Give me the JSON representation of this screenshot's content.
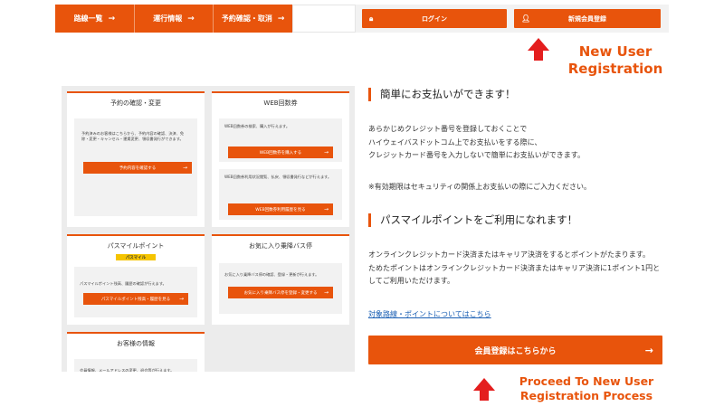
{
  "topnav": {
    "items": [
      {
        "label": "路線一覧"
      },
      {
        "label": "運行情報"
      },
      {
        "label": "予約確認・取消"
      }
    ]
  },
  "account": {
    "login_label": "ログイン",
    "register_label": "新規会員登録"
  },
  "annotations": {
    "new_user": "New User Registration",
    "proceed": "Proceed To New User Registration Process"
  },
  "cards": {
    "reserve": {
      "title": "予約の確認・変更",
      "body": "予約済みのお客様はこちらから、予約内容の確認、決済、免除・変更・キャンセル・運賃変更、領収書発行ができます。",
      "button": "予約内容を確認する"
    },
    "web_ticket": {
      "title": "WEB回数券",
      "body1": "WEB回数券の検索、購入が行えます。",
      "button1": "WEB回数券を購入する",
      "body2": "WEB回数券利用状況閲覧、払戻、領収書発行などが行えます。",
      "button2": "WEB回数券利用履歴を見る"
    },
    "pass_mile": {
      "title": "パスマイルポイント",
      "badge": "パスマイル",
      "body": "パスマイルポイント残高、履歴の確認が行えます。",
      "button": "パスマイルポイント残高・履歴を見る"
    },
    "favorite": {
      "title": "お気に入り乗降バス停",
      "body": "お気に入り乗降バス停の確認、登録・更新が行えます。",
      "button": "お気に入り乗降バス停を登録・変更する"
    },
    "customer": {
      "title": "お客様の情報",
      "body": "会員情報、メールアドレスの変更、退会等が行えます。"
    }
  },
  "content": {
    "heading1": "簡単にお支払いができます！",
    "para1": "あらかじめクレジット番号を登録しておくことで\nハイウェイバスドットコム上でお支払いをする際に、\nクレジットカード番号を入力しないで簡単にお支払いができます。",
    "note": "※有効期限はセキュリティの関係上お支払いの際にご入力ください。",
    "heading2": "パスマイルポイントをご利用になれます！",
    "para2": "オンラインクレジットカード決済またはキャリア決済をするとポイントがたまります。\nためたポイントはオンラインクレジットカード決済またはキャリア決済に1ポイント1円としてご利用いただけます。",
    "link": "対象路線・ポイントについてはこちら",
    "cta": "会員登録はこちらから"
  }
}
